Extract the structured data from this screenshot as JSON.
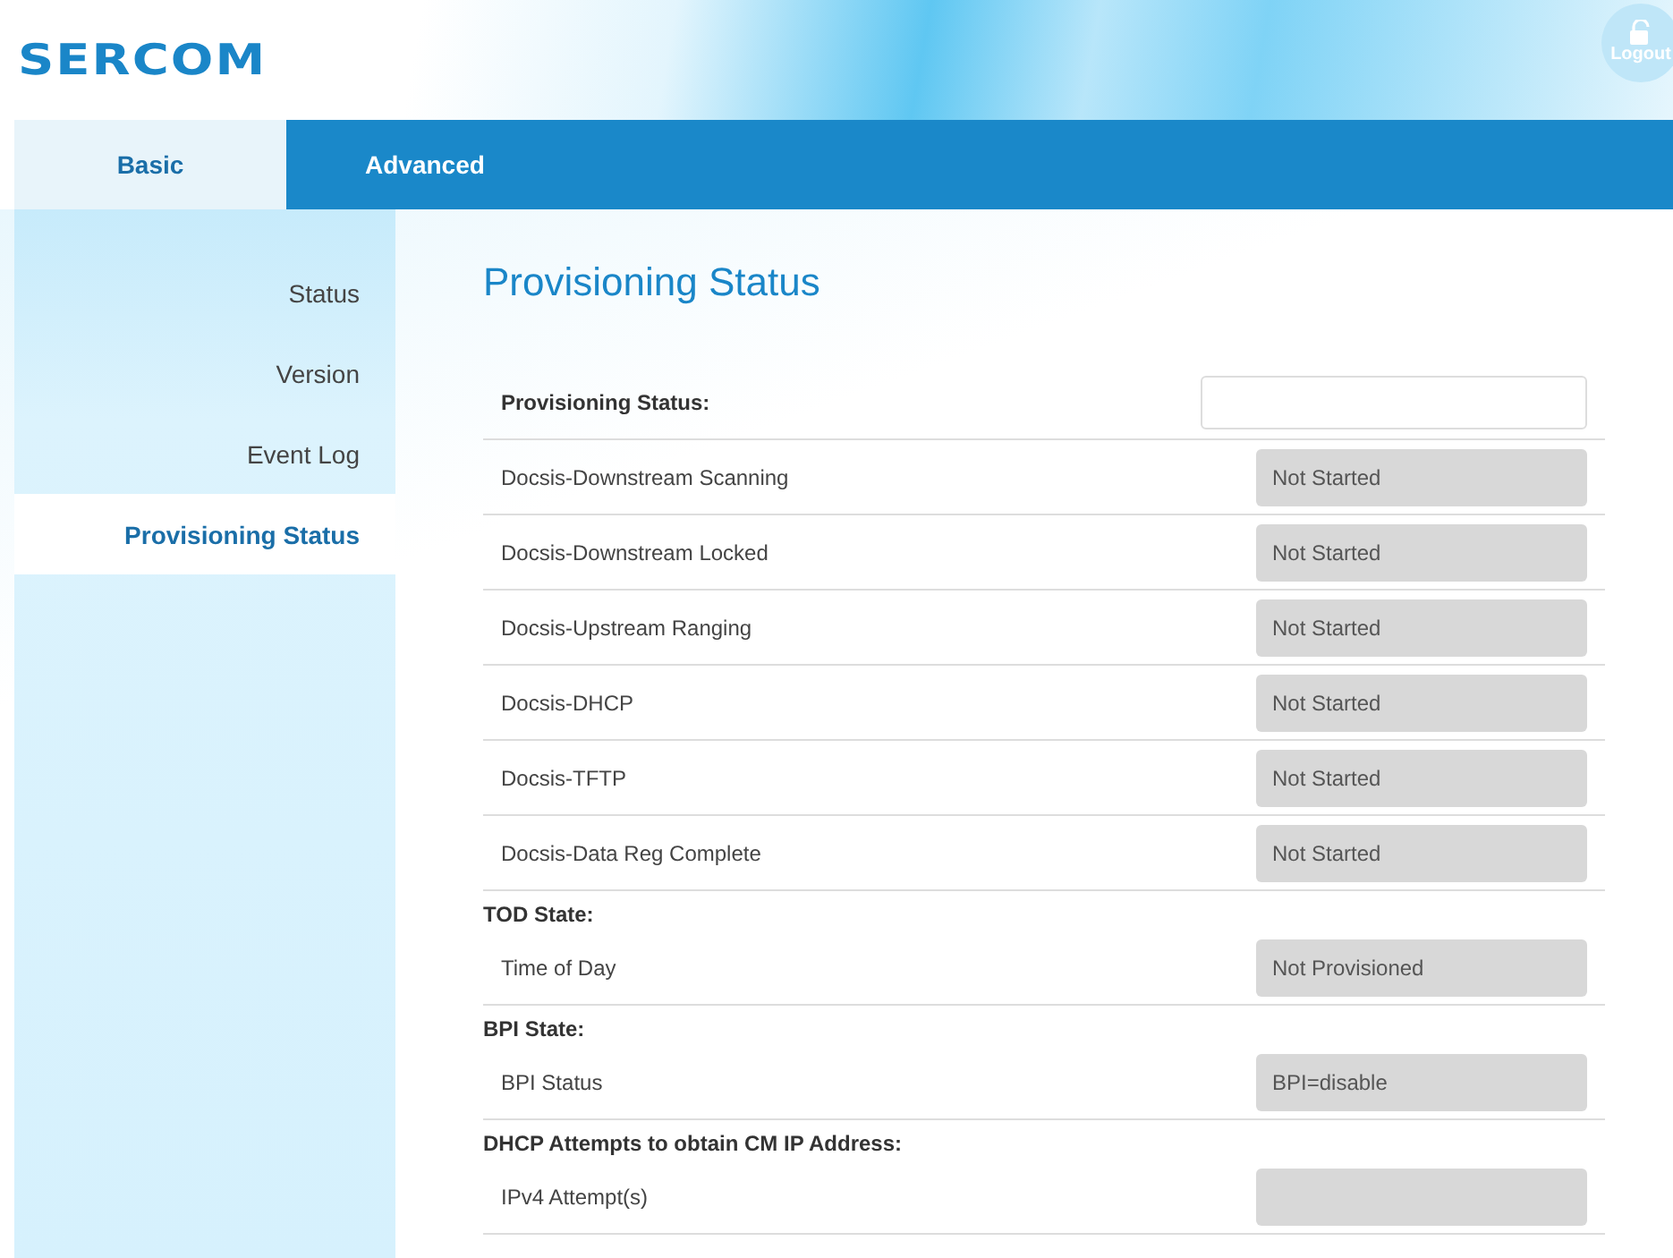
{
  "header": {
    "logo": "SERCOM",
    "logout": "Logout"
  },
  "tabs": [
    {
      "label": "Basic",
      "selected": true
    },
    {
      "label": "Advanced",
      "selected": false
    }
  ],
  "sidebar": {
    "items": [
      {
        "label": "Status",
        "selected": false
      },
      {
        "label": "Version",
        "selected": false
      },
      {
        "label": "Event Log",
        "selected": false
      },
      {
        "label": "Provisioning Status",
        "selected": true
      }
    ]
  },
  "page_title": "Provisioning Status",
  "sections": [
    {
      "kind": "field",
      "heading": "Provisioning Status:",
      "rows": [
        {
          "label": "Docsis-Downstream Scanning",
          "value": "Not Started"
        },
        {
          "label": "Docsis-Downstream Locked",
          "value": "Not Started"
        },
        {
          "label": "Docsis-Upstream Ranging",
          "value": "Not Started"
        },
        {
          "label": "Docsis-DHCP",
          "value": "Not Started"
        },
        {
          "label": "Docsis-TFTP",
          "value": "Not Started"
        },
        {
          "label": "Docsis-Data Reg Complete",
          "value": "Not Started"
        }
      ]
    },
    {
      "kind": "plain",
      "heading": "TOD State:",
      "rows": [
        {
          "label": "Time of Day",
          "value": "Not Provisioned"
        }
      ]
    },
    {
      "kind": "plain",
      "heading": "BPI State:",
      "rows": [
        {
          "label": "BPI Status",
          "value": "BPI=disable"
        }
      ]
    },
    {
      "kind": "plain",
      "heading": "DHCP Attempts to obtain CM IP Address:",
      "rows": [
        {
          "label": "IPv4 Attempt(s)"
        }
      ]
    }
  ]
}
